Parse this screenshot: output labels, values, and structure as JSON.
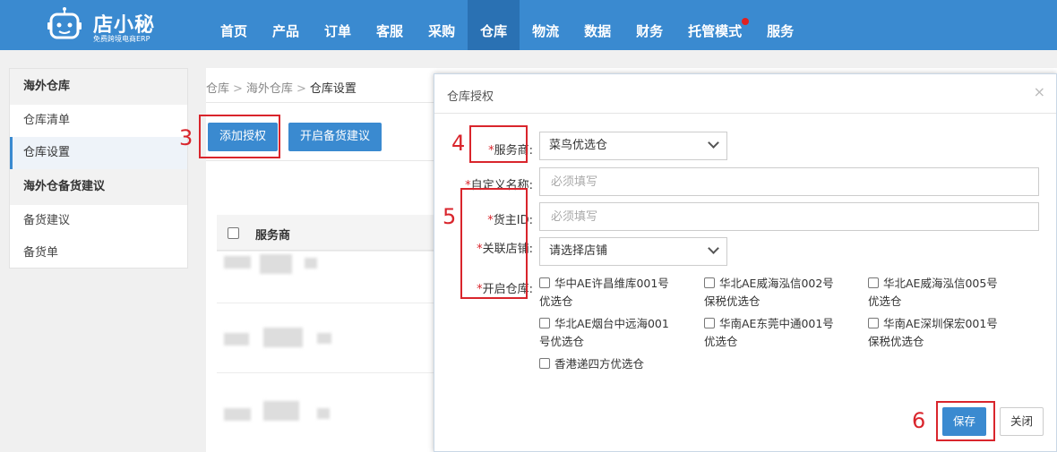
{
  "logo": {
    "name": "店小秘",
    "tagline": "免费跨境电商ERP"
  },
  "nav": [
    {
      "label": "首页"
    },
    {
      "label": "产品"
    },
    {
      "label": "订单"
    },
    {
      "label": "客服"
    },
    {
      "label": "采购"
    },
    {
      "label": "仓库",
      "active": true
    },
    {
      "label": "物流"
    },
    {
      "label": "数据"
    },
    {
      "label": "财务"
    },
    {
      "label": "托管模式",
      "dot": true
    },
    {
      "label": "服务"
    }
  ],
  "sidebar": {
    "groups": [
      {
        "title": "海外仓库",
        "items": [
          {
            "label": "仓库清单"
          },
          {
            "label": "仓库设置",
            "active": true
          }
        ]
      },
      {
        "title": "海外仓备货建议",
        "items": [
          {
            "label": "备货建议"
          },
          {
            "label": "备货单"
          }
        ]
      }
    ]
  },
  "breadcrumb": {
    "items": [
      "仓库",
      "海外仓库"
    ],
    "sep": ">",
    "current": "仓库设置"
  },
  "toolbar": {
    "add_auth": "添加授权",
    "stock_suggest": "开启备货建议"
  },
  "table": {
    "header_col": "服务商"
  },
  "annotations": {
    "n3": "3",
    "n4": "4",
    "n5": "5",
    "n6": "6",
    "color": "#d9252c"
  },
  "modal": {
    "title": "仓库授权",
    "close_icon": "×",
    "fields": {
      "provider": {
        "label": "服务商:",
        "value": "菜鸟优选仓"
      },
      "custom_name": {
        "label": "自定义名称:",
        "placeholder": "必须填写"
      },
      "owner_id": {
        "label": "货主ID:",
        "placeholder": "必须填写"
      },
      "store": {
        "label": "关联店铺:",
        "value": "请选择店铺"
      },
      "warehouses": {
        "label": "开启仓库:"
      }
    },
    "required_mark": "*",
    "warehouses": [
      {
        "line1": "华中AE许昌维库001号",
        "line2": "优选仓"
      },
      {
        "line1": "华北AE威海泓信002号",
        "line2": "保税优选仓"
      },
      {
        "line1": "华北AE威海泓信005号",
        "line2": "优选仓"
      },
      {
        "line1": "华北AE烟台中远海001",
        "line2": "号优选仓"
      },
      {
        "line1": "华南AE东莞中通001号",
        "line2": "优选仓"
      },
      {
        "line1": "华南AE深圳保宏001号",
        "line2": "保税优选仓"
      },
      {
        "line1": "香港递四方优选仓",
        "line2": ""
      }
    ],
    "buttons": {
      "save": "保存",
      "close": "关闭"
    }
  },
  "colors": {
    "primary": "#3a8ad0",
    "nav_active": "#2a71b3",
    "annotation": "#d9252c"
  }
}
